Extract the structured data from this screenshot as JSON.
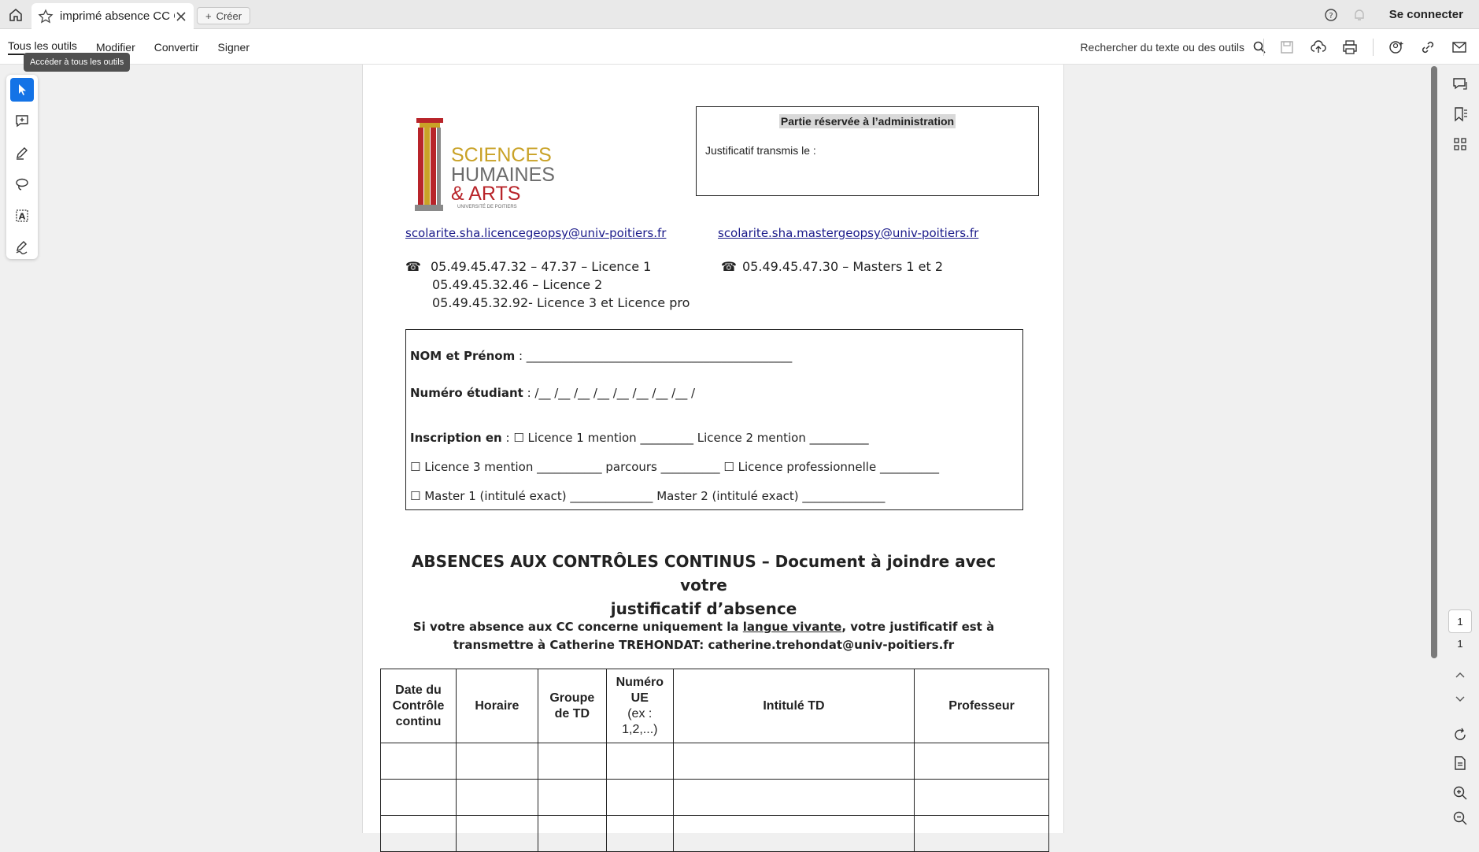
{
  "tab": {
    "title": "imprimé absence CC C...",
    "create_label": "Créer"
  },
  "topbar": {
    "signin_label": "Se connecter"
  },
  "menu": {
    "items": [
      "Tous les outils",
      "Modifier",
      "Convertir",
      "Signer"
    ],
    "search_label": "Rechercher du texte ou des outils"
  },
  "tooltip": "Accéder à tous les outils",
  "pager": {
    "current": "1",
    "total": "1"
  },
  "document": {
    "logo_lines": [
      "SCIENCES",
      "HUMAINES",
      "& ARTS",
      "UNIVERSITÉ DE POITIERS"
    ],
    "admin": {
      "title": "Partie réservée à l’administration",
      "line": "Justificatif transmis le :"
    },
    "email_left": "scolarite.sha.licencegeopsy@univ-poitiers.fr",
    "email_right": "scolarite.sha.mastergeopsy@univ-poitiers.fr",
    "phones_left": [
      "05.49.45.47.32 – 47.37 – Licence 1",
      "05.49.45.32.46 – Licence 2",
      "05.49.45.32.92-  Licence 3 et Licence pro"
    ],
    "phones_right": [
      "05.49.45.47.30 – Masters 1 et 2"
    ],
    "form": {
      "name_label": "NOM et Prénom",
      "name_rest": " : _____________________________________________",
      "student_label": "Numéro étudiant",
      "student_rest": " : /__ /__ /__ /__ /__ /__ /__ /__ /",
      "insc_label": "Inscription en",
      "insc_rest": " : ☐  Licence 1 mention _________ Licence 2 mention __________",
      "line4": "☐  Licence 3 mention ___________ parcours __________  ☐  Licence professionnelle __________",
      "line5": "☐  Master 1 (intitulé exact)  ______________     Master 2 (intitulé exact) ______________"
    },
    "title_line1": "ABSENCES AUX CONTRÔLES CONTINUS – Document à joindre avec votre",
    "title_line2": "justificatif d’absence",
    "sub_part1": "Si votre absence aux CC concerne uniquement la ",
    "sub_underlined": "langue vivante",
    "sub_part2": ", votre justificatif est à",
    "sub_line2": "transmettre à Catherine TREHONDAT: catherine.trehondat@univ-poitiers.fr",
    "table_headers": {
      "date": "Date du Contrôle continu",
      "horaire": "Horaire",
      "groupe": "Groupe de TD",
      "numero": "Numéro UE",
      "numero_note": "(ex : 1,2,...)",
      "intitule": "Intitulé TD",
      "professeur": "Professeur"
    }
  },
  "colors": {
    "accent": "#1473e6",
    "link": "#1a1a8a",
    "logo_gold": "#c9a227",
    "logo_red": "#b8242a",
    "logo_gray": "#6b6b6b"
  }
}
